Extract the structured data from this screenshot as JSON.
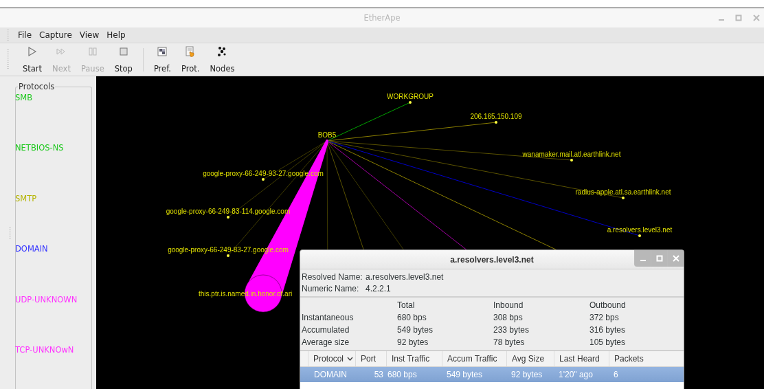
{
  "window": {
    "title": "EtherApe"
  },
  "menu": [
    "File",
    "Capture",
    "View",
    "Help"
  ],
  "toolbar": [
    [
      {
        "kind": "start",
        "label": "Start",
        "disabled": false
      },
      {
        "kind": "next",
        "label": "Next",
        "disabled": true
      },
      {
        "kind": "pause",
        "label": "Pause",
        "disabled": true
      },
      {
        "kind": "stop",
        "label": "Stop",
        "disabled": false
      }
    ],
    [
      {
        "kind": "pref",
        "label": "Pref.",
        "disabled": false
      },
      {
        "kind": "prot",
        "label": "Prot.",
        "disabled": false
      },
      {
        "kind": "nodes",
        "label": "Nodes",
        "disabled": false
      }
    ]
  ],
  "protocols": {
    "title": "Protocols",
    "items": [
      {
        "name": "SMB",
        "color": "#1cc81c"
      },
      {
        "name": "NETBIOS-NS",
        "color": "#1cc81c"
      },
      {
        "name": "SMTP",
        "color": "#b4b400"
      },
      {
        "name": "DOMAIN",
        "color": "#3333ff"
      },
      {
        "name": "UDP-UNKNOWN",
        "color": "#ff33ff"
      },
      {
        "name": "TCP-UNKNOwN",
        "color": "#ff33ff"
      }
    ]
  },
  "graph": {
    "nodes": [
      {
        "label": "BOB5",
        "kind": "center"
      },
      {
        "label": "WORKGROUP",
        "kind": "host",
        "color": "#00a000"
      },
      {
        "label": "206.165.150.109",
        "kind": "host",
        "color": "#8a7e00"
      },
      {
        "label": "wanamaker.mail.atl.earthlink.net",
        "kind": "host",
        "color": "#5a5200"
      },
      {
        "label": "radius-apple.atl.sa.earthlink.net",
        "kind": "host",
        "color": "#5a5200"
      },
      {
        "label": "a.resolvers.level3.net",
        "kind": "host",
        "color": "#0000c8"
      },
      {
        "label": "google-proxy-66-249-93-27.google.com",
        "kind": "host",
        "color": "#3e3a00"
      },
      {
        "label": "google-proxy-66-249-83-114.google.com",
        "kind": "host",
        "color": "#3e3a00"
      },
      {
        "label": "google-proxy-66-249-83-27.google.com",
        "kind": "host",
        "color": "#3e3a00"
      },
      {
        "label": "this.ptr.is.named.in.honor.of.ari",
        "kind": "large",
        "color": "#ff00ff"
      }
    ]
  },
  "node_info": {
    "title": "a.resolvers.level3.net",
    "fields": [
      {
        "label": "Resolved Name:",
        "value": "a.resolvers.level3.net"
      },
      {
        "label": "Numeric Name:",
        "value": "4.2.2.1"
      }
    ],
    "stats": {
      "columns": [
        "Total",
        "Inbound",
        "Outbound"
      ],
      "rows": [
        {
          "label": "Instantaneous",
          "values": [
            "680 bps",
            "308 bps",
            "372 bps"
          ]
        },
        {
          "label": "Accumulated",
          "values": [
            "549 bytes",
            "233 bytes",
            "316 bytes"
          ]
        },
        {
          "label": "Average size",
          "values": [
            "92 bytes",
            "78 bytes",
            "105 bytes"
          ]
        }
      ]
    },
    "table": {
      "columns": [
        {
          "label": "Protocol",
          "sorted": true
        },
        {
          "label": "Port",
          "sorted": false
        },
        {
          "label": "Inst Traffic",
          "sorted": false
        },
        {
          "label": "Accum Traffic",
          "sorted": false
        },
        {
          "label": "Avg Size",
          "sorted": false
        },
        {
          "label": "Last Heard",
          "sorted": false
        },
        {
          "label": "Packets",
          "sorted": false
        }
      ],
      "rows": [
        {
          "cells": [
            "DOMAIN",
            "53",
            "680 bps",
            "549 bytes",
            "92 bytes",
            "1'20\" ago",
            "6"
          ],
          "selected": true
        }
      ]
    }
  }
}
